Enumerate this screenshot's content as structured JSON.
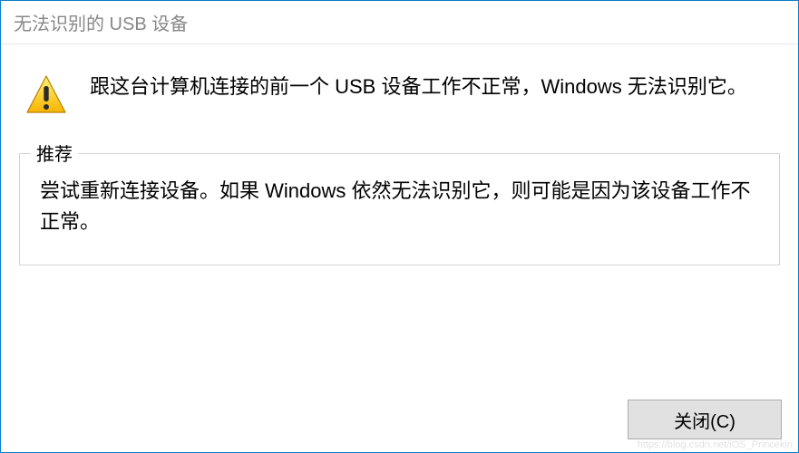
{
  "titlebar": {
    "title": "无法识别的 USB 设备"
  },
  "message": {
    "icon": "warning-icon",
    "text": "跟这台计算机连接的前一个 USB 设备工作不正常，Windows 无法识别它。"
  },
  "recommendation": {
    "legend": "推荐",
    "text": "尝试重新连接设备。如果 Windows 依然无法识别它，则可能是因为该设备工作不正常。"
  },
  "buttons": {
    "close_label": "关闭(C)"
  },
  "watermark": "https://blog.csdn.net/iOS_Princekin"
}
